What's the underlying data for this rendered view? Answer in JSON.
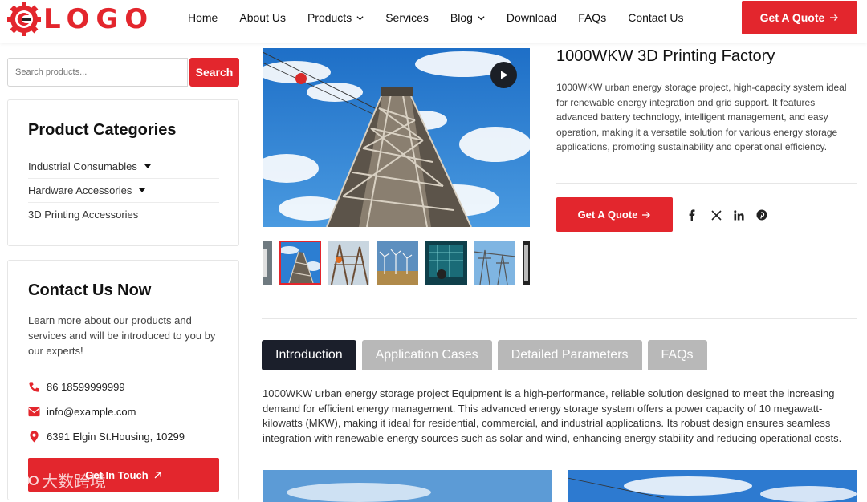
{
  "header": {
    "logo_text": "LOGO",
    "nav": [
      {
        "label": "Home",
        "has_dropdown": false
      },
      {
        "label": "About Us",
        "has_dropdown": false
      },
      {
        "label": "Products",
        "has_dropdown": true
      },
      {
        "label": "Services",
        "has_dropdown": false
      },
      {
        "label": "Blog",
        "has_dropdown": true
      },
      {
        "label": "Download",
        "has_dropdown": false
      },
      {
        "label": "FAQs",
        "has_dropdown": false
      },
      {
        "label": "Contact Us",
        "has_dropdown": false
      }
    ],
    "cta_label": "Get A Quote"
  },
  "sidebar": {
    "search_placeholder": "Search products...",
    "search_button": "Search",
    "categories_title": "Product Categories",
    "categories": [
      {
        "label": "Industrial Consumables",
        "has_dropdown": true
      },
      {
        "label": "Hardware Accessories",
        "has_dropdown": true
      },
      {
        "label": "3D Printing Accessories",
        "has_dropdown": false
      }
    ],
    "contact_title": "Contact Us Now",
    "contact_desc": "Learn more about our products and services and will be introduced to you by our experts!",
    "phone": "86 18599999999",
    "email": "info@example.com",
    "address": "6391 Elgin St.Housing, 10299",
    "touch_button": "Get In Touch"
  },
  "product": {
    "title": "1000WKW 3D Printing Factory",
    "description": "1000WKW urban energy storage project, high-capacity system ideal for renewable energy integration and grid support. It features advanced battery technology, intelligent management, and easy operation, making it a versatile solution for various energy storage applications, promoting sustainability and operational efficiency.",
    "quote_button": "Get A Quote",
    "socials": [
      "facebook-icon",
      "x-icon",
      "linkedin-icon",
      "pinterest-icon"
    ]
  },
  "tabs": [
    {
      "label": "Introduction",
      "active": true
    },
    {
      "label": "Application Cases",
      "active": false
    },
    {
      "label": "Detailed Parameters",
      "active": false
    },
    {
      "label": "FAQs",
      "active": false
    }
  ],
  "intro_text": "1000WKW urban energy storage project Equipment is a high-performance, reliable solution designed to meet the increasing demand for efficient energy management. This advanced energy storage system offers a power capacity of 10 megawatt-kilowatts (MKW), making it ideal for residential, commercial, and industrial applications. Its robust design ensures seamless integration with renewable energy sources such as solar and wind, enhancing energy stability and reducing operational costs.",
  "watermark": "大数跨境",
  "colors": {
    "accent": "#e3262d",
    "dark": "#1b1f2b",
    "tab_inactive": "#b8b8b8"
  }
}
